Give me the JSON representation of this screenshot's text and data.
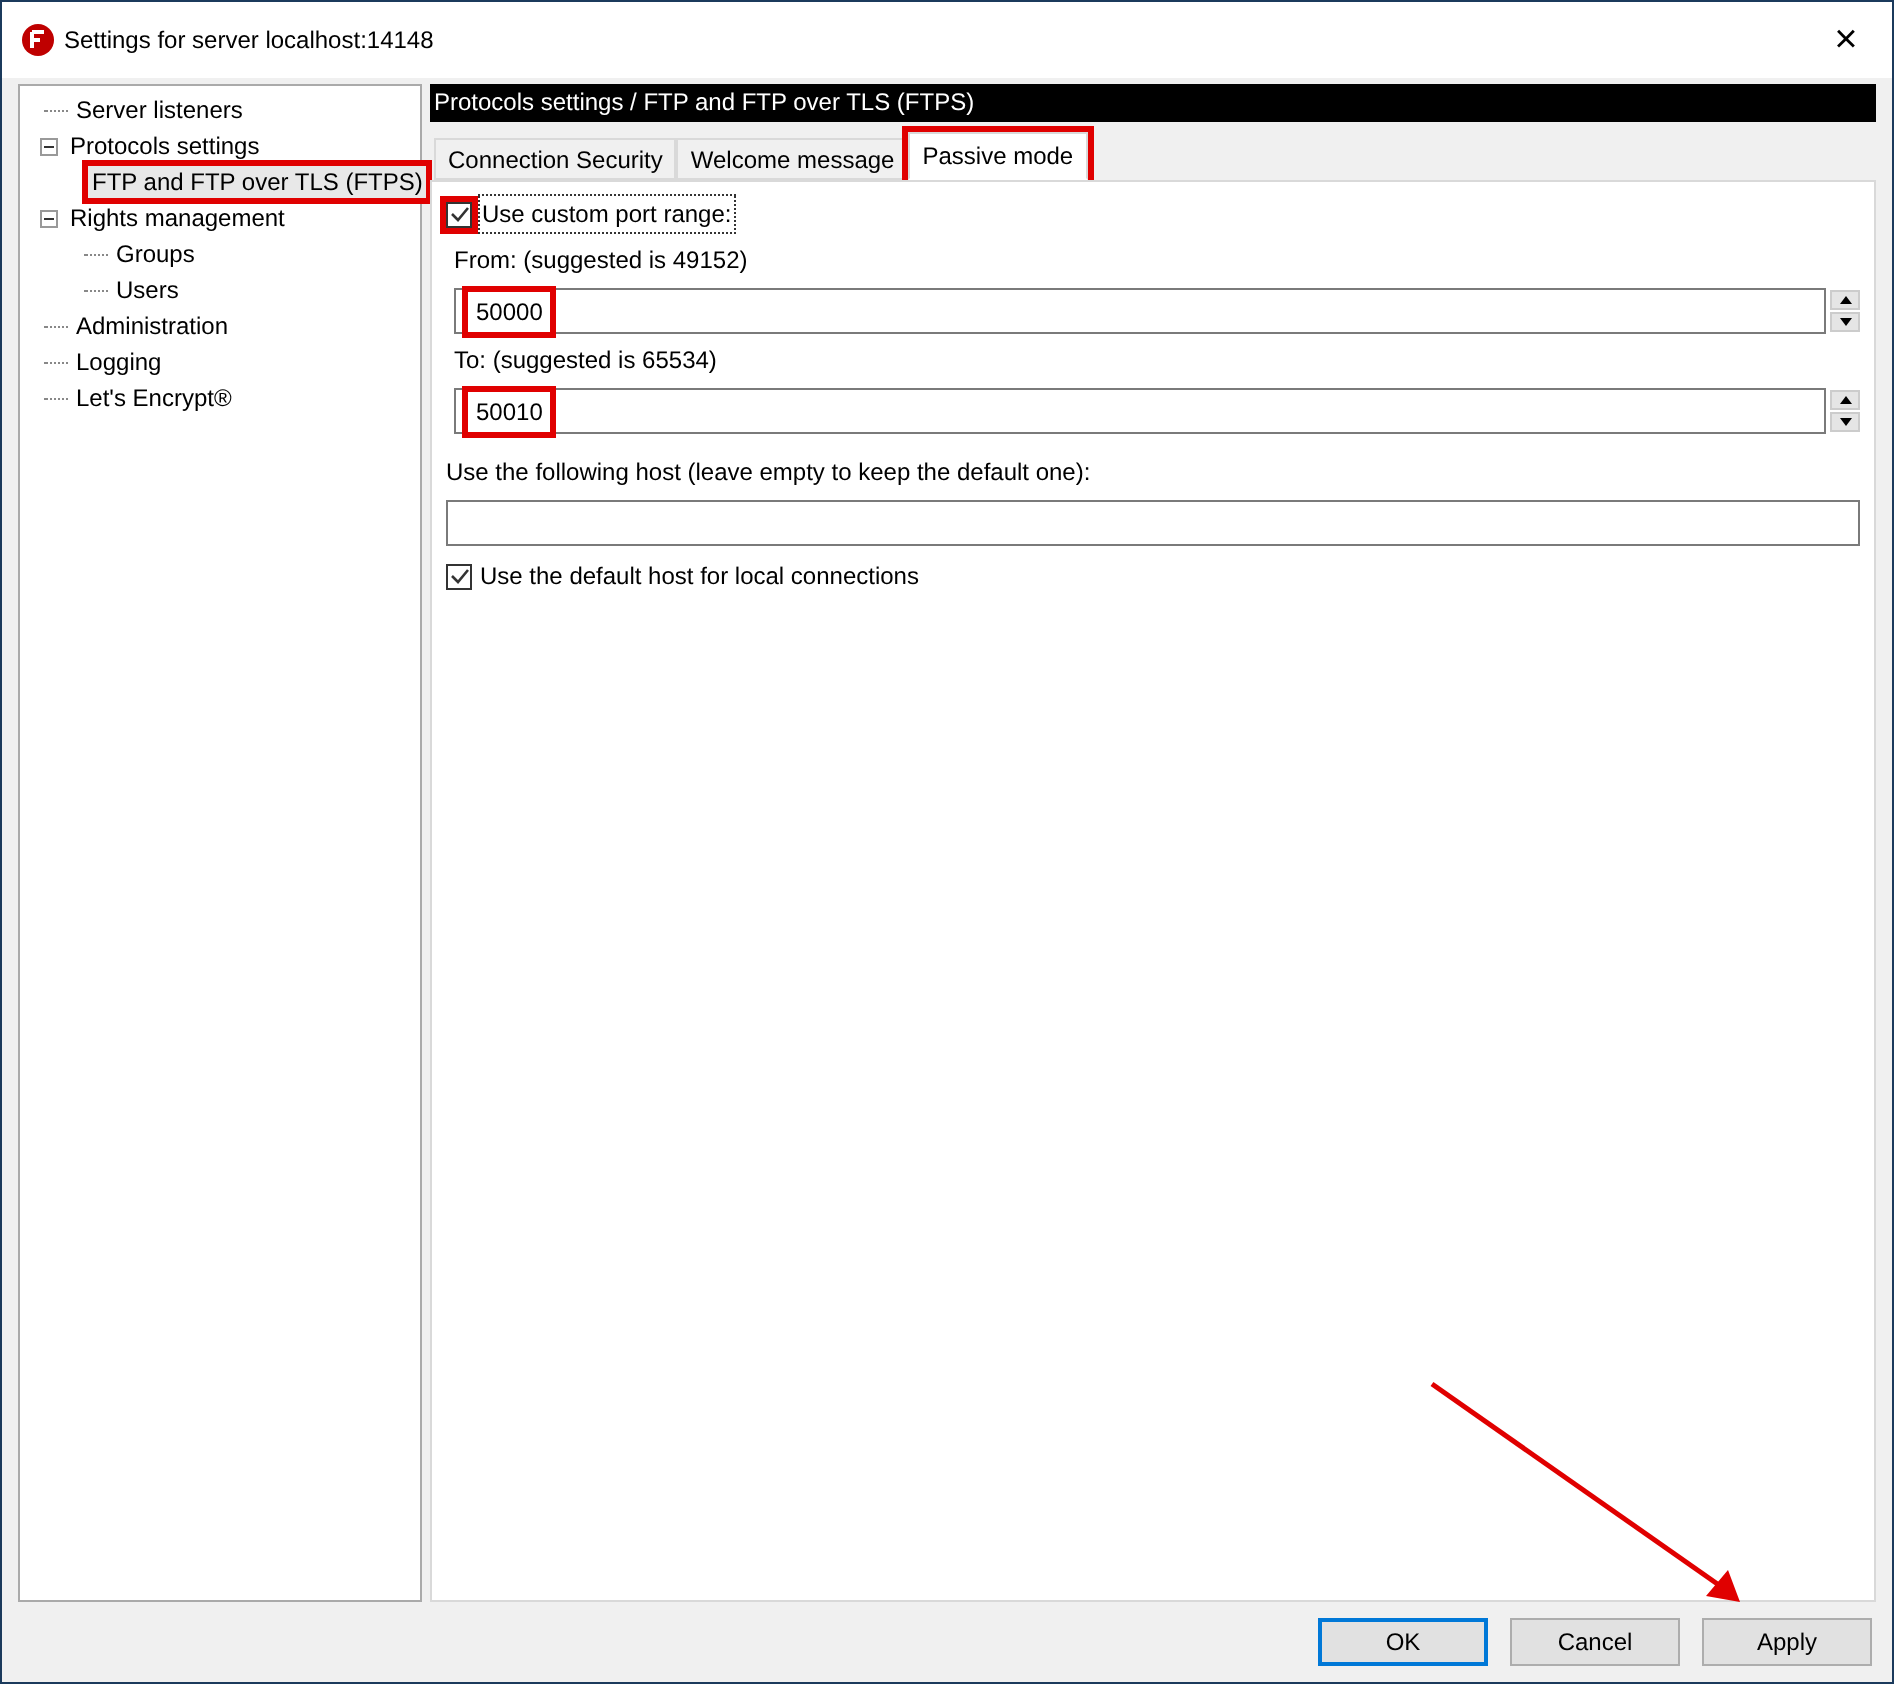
{
  "window": {
    "title": "Settings for server localhost:14148",
    "close_label": "×"
  },
  "tree": [
    {
      "label": "Server listeners",
      "selected": false,
      "highlighted": false
    },
    {
      "label": "Protocols settings",
      "selected": false,
      "highlighted": false,
      "expanded": true,
      "children": [
        {
          "label": "FTP and FTP over TLS (FTPS)",
          "selected": true,
          "highlighted": true
        }
      ]
    },
    {
      "label": "Rights management",
      "selected": false,
      "highlighted": false,
      "expanded": true,
      "children": [
        {
          "label": "Groups",
          "selected": false,
          "highlighted": false
        },
        {
          "label": "Users",
          "selected": false,
          "highlighted": false
        }
      ]
    },
    {
      "label": "Administration",
      "selected": false,
      "highlighted": false
    },
    {
      "label": "Logging",
      "selected": false,
      "highlighted": false
    },
    {
      "label": "Let's Encrypt®",
      "selected": false,
      "highlighted": false
    }
  ],
  "header": "Protocols settings / FTP and FTP over TLS (FTPS)",
  "tabs": [
    {
      "label": "Connection Security",
      "selected": false,
      "highlighted": false
    },
    {
      "label": "Welcome message",
      "selected": false,
      "highlighted": false
    },
    {
      "label": "Passive mode",
      "selected": true,
      "highlighted": true
    }
  ],
  "custom_range": {
    "label": "Use custom port range:",
    "checked": true,
    "highlighted": true
  },
  "from": {
    "label": "From: (suggested is 49152)",
    "value": "50000",
    "highlighted": true
  },
  "to": {
    "label": "To: (suggested is 65534)",
    "value": "50010",
    "highlighted": true
  },
  "host": {
    "label": "Use the following host (leave empty to keep the default one):"
  },
  "default_host": {
    "label": "Use the default host for local connections",
    "checked": true
  },
  "buttons": [
    {
      "label": "OK",
      "default": true
    },
    {
      "label": "Cancel",
      "default": false
    },
    {
      "label": "Apply",
      "default": false
    }
  ],
  "annotation_arrow": true
}
